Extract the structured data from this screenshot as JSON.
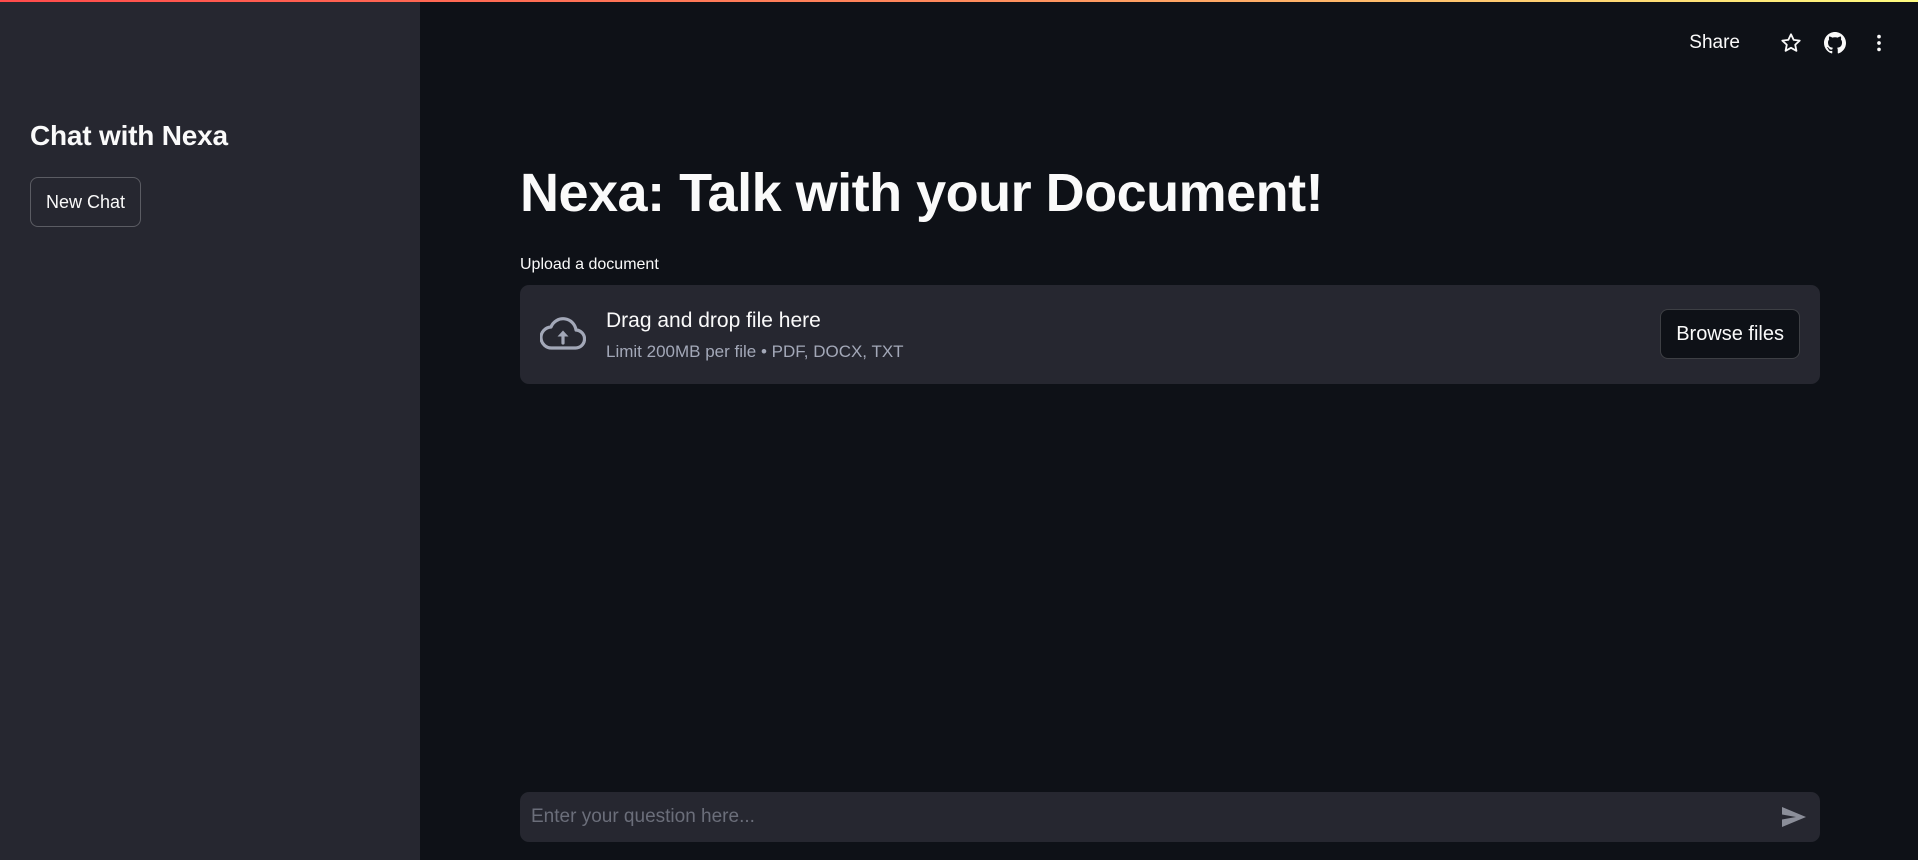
{
  "sidebar": {
    "title": "Chat with Nexa",
    "new_chat_label": "New Chat"
  },
  "toolbar": {
    "share_label": "Share",
    "icons": [
      "star-icon",
      "github-icon",
      "more-vertical-icon"
    ]
  },
  "main": {
    "title": "Nexa: Talk with your Document!",
    "uploader": {
      "label": "Upload a document",
      "drop_text": "Drag and drop file here",
      "limit_text": "Limit 200MB per file • PDF, DOCX, TXT",
      "browse_label": "Browse files",
      "icon": "cloud-upload-icon"
    },
    "chat_input": {
      "placeholder": "Enter your question here...",
      "value": "",
      "send_icon": "send-icon"
    }
  },
  "colors": {
    "background": "#0e1117",
    "sidebar": "#262730",
    "text": "#fafafa",
    "muted_text": "#a3a8b8",
    "accent_gradient_start": "#ff4b4b",
    "accent_gradient_end": "#fffd80"
  }
}
